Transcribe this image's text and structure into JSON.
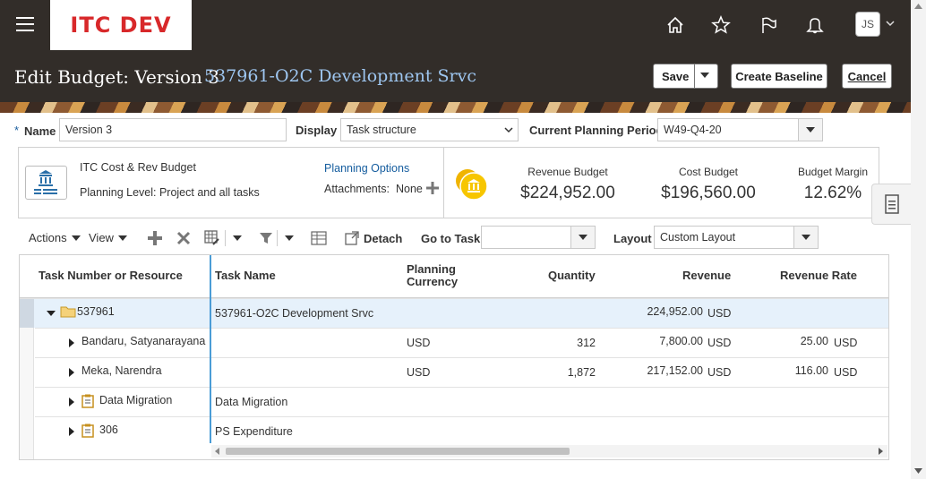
{
  "header": {
    "logo_text": "ITC DEV",
    "user_initials": "JS",
    "icons": [
      "home-icon",
      "star-icon",
      "flag-icon",
      "bell-icon"
    ]
  },
  "page": {
    "title": "Edit Budget: Version 3",
    "subtitle": "537961-O2C Development Srvc",
    "buttons": {
      "save": "Save",
      "create_baseline": "Create Baseline",
      "cancel": "Cancel"
    }
  },
  "form": {
    "name_label": "Name",
    "name_value": "Version 3",
    "display_label": "Display",
    "display_value": "Task structure",
    "period_label": "Current Planning Period",
    "period_value": "W49-Q4-20"
  },
  "info": {
    "budget_type": "ITC Cost & Rev Budget",
    "planning_level": "Planning Level: Project and all tasks",
    "planning_options": "Planning Options",
    "attachments_label": "Attachments:",
    "attachments_value": "None"
  },
  "metrics": [
    {
      "label": "Revenue Budget",
      "value": "$224,952.00"
    },
    {
      "label": "Cost Budget",
      "value": "$196,560.00"
    },
    {
      "label": "Budget Margin",
      "value": "12.62%"
    }
  ],
  "toolbar": {
    "actions": "Actions",
    "view": "View",
    "detach": "Detach",
    "goto_label": "Go to Task",
    "goto_value": "",
    "layout_label": "Layout",
    "layout_value": "Custom Layout"
  },
  "table": {
    "columns": {
      "task": "Task Number or Resource",
      "name": "Task Name",
      "currency_1": "Planning",
      "currency_2": "Currency",
      "quantity": "Quantity",
      "revenue": "Revenue",
      "rate": "Revenue Rate"
    },
    "rows": [
      {
        "task": "537961",
        "name": "537961-O2C Development Srvc",
        "currency": "",
        "quantity": "",
        "revenue": "224,952.00",
        "revenue_cur": "USD",
        "rate": "",
        "rate_cur": ""
      },
      {
        "task": "Bandaru, Satyanarayana",
        "name": "",
        "currency": "USD",
        "quantity": "312",
        "revenue": "7,800.00",
        "revenue_cur": "USD",
        "rate": "25.00",
        "rate_cur": "USD"
      },
      {
        "task": "Meka, Narendra",
        "name": "",
        "currency": "USD",
        "quantity": "1,872",
        "revenue": "217,152.00",
        "revenue_cur": "USD",
        "rate": "116.00",
        "rate_cur": "USD"
      },
      {
        "task": "Data Migration",
        "name": "Data Migration",
        "currency": "",
        "quantity": "",
        "revenue": "",
        "revenue_cur": "",
        "rate": "",
        "rate_cur": ""
      },
      {
        "task": "306",
        "name": "PS Expenditure",
        "currency": "",
        "quantity": "",
        "revenue": "",
        "revenue_cur": "",
        "rate": "",
        "rate_cur": ""
      }
    ]
  }
}
